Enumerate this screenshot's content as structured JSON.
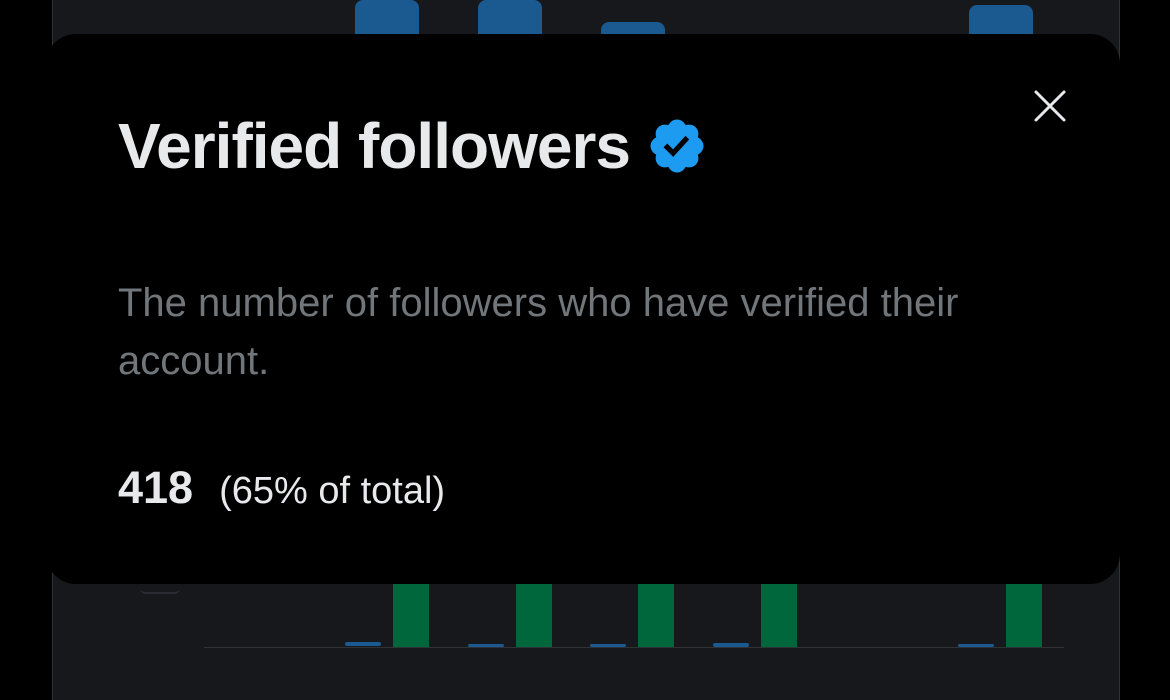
{
  "modal": {
    "title": "Verified followers",
    "title_icon": "verified-badge-icon",
    "description": "The number of followers who have verified their account.",
    "stat_value": "418",
    "stat_percent": "(65% of total)",
    "close_icon": "close-icon"
  },
  "colors": {
    "verified_badge": "#1d9bf0",
    "bar_blue": "#1a5a90",
    "bar_green": "#00673d",
    "modal_bg": "#000000",
    "card_bg": "#16181c",
    "title_text": "#e7e9ea",
    "muted_text": "#71767b"
  }
}
